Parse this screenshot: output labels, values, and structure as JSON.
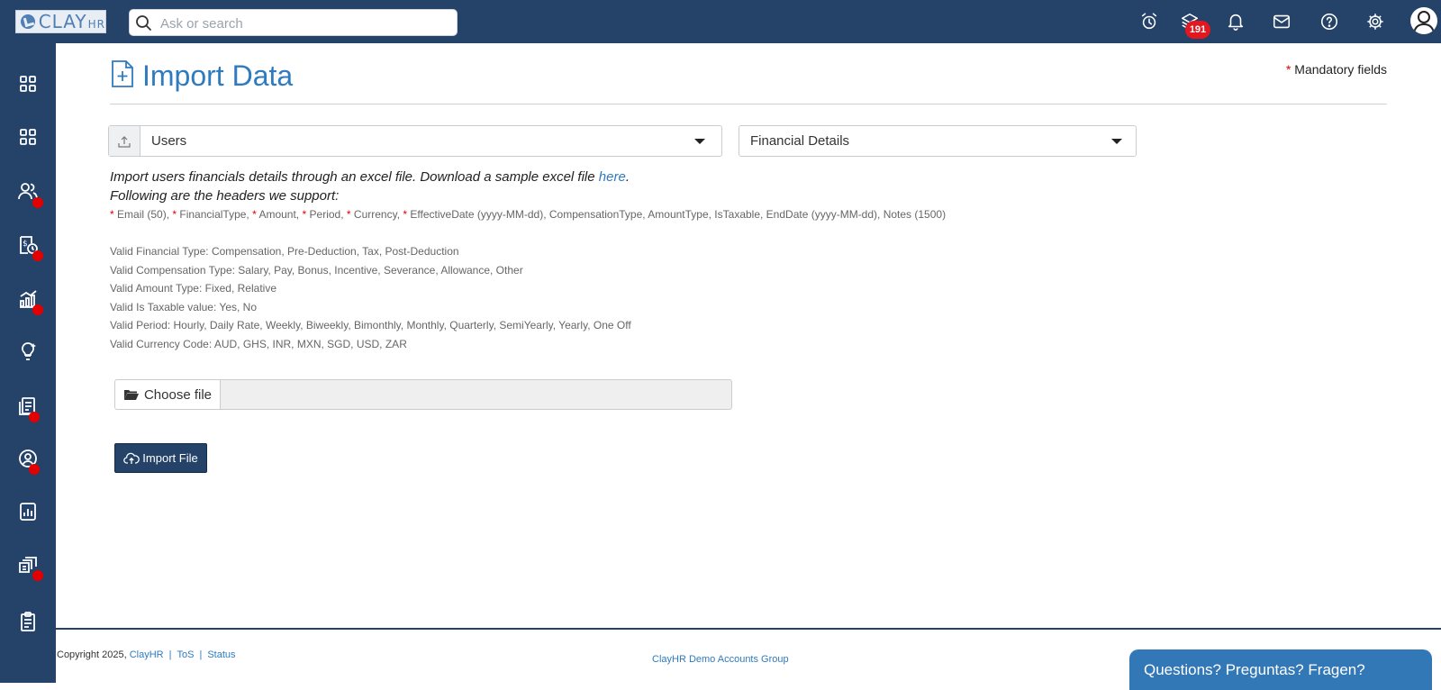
{
  "header": {
    "logo_text": "CLAY",
    "logo_suffix": "HR",
    "search_placeholder": "Ask or search",
    "notification_count": "191",
    "icons": [
      "alarm-clock-icon",
      "layers-icon",
      "bell-icon",
      "mail-icon",
      "help-icon",
      "settings-icon",
      "user-avatar-icon"
    ]
  },
  "sidebar": {
    "items": [
      {
        "icon": "dashboard-icon",
        "has_dot": false
      },
      {
        "icon": "apps-icon",
        "has_dot": false
      },
      {
        "icon": "people-icon",
        "has_dot": true
      },
      {
        "icon": "payroll-icon",
        "has_dot": true
      },
      {
        "icon": "analytics-icon",
        "has_dot": true
      },
      {
        "icon": "ideas-icon",
        "has_dot": false
      },
      {
        "icon": "documents-icon",
        "has_dot": true
      },
      {
        "icon": "profile-icon",
        "has_dot": true
      },
      {
        "icon": "reports-icon",
        "has_dot": false
      },
      {
        "icon": "support-icon",
        "has_dot": true
      },
      {
        "icon": "checklist-icon",
        "has_dot": false
      }
    ]
  },
  "page": {
    "title": "Import Data",
    "mandatory_asterisk": "*",
    "mandatory_label": "Mandatory fields"
  },
  "form": {
    "type_select_value": "Users",
    "detail_select_value": "Financial Details",
    "description_line1": "Import users financials details through an excel file. Download a sample excel file ",
    "description_link": "here",
    "description_period": ".",
    "description_line2": "Following are the headers we support:",
    "headers": [
      {
        "required": true,
        "text": "Email (50),"
      },
      {
        "required": true,
        "text": "FinancialType,"
      },
      {
        "required": true,
        "text": "Amount,"
      },
      {
        "required": true,
        "text": "Period,"
      },
      {
        "required": true,
        "text": "Currency,"
      },
      {
        "required": true,
        "text": "EffectiveDate (yyyy-MM-dd), CompensationType, AmountType, IsTaxable, EndDate (yyyy-MM-dd), Notes (1500)"
      }
    ],
    "valid_values": [
      "Valid Financial Type: Compensation, Pre-Deduction, Tax, Post-Deduction",
      "Valid Compensation Type: Salary, Pay, Bonus, Incentive, Severance, Allowance, Other",
      "Valid Amount Type: Fixed, Relative",
      "Valid Is Taxable value: Yes, No",
      "Valid Period: Hourly, Daily Rate, Weekly, Biweekly, Bimonthly, Monthly, Quarterly, SemiYearly, Yearly, One Off",
      "Valid Currency Code: AUD, GHS, INR, MXN, SGD, USD, ZAR"
    ],
    "choose_file_label": "Choose file",
    "file_value": "",
    "import_button_label": "Import File"
  },
  "footer": {
    "copyright_prefix": "Copyright 2025,",
    "links": [
      "ClayHR",
      "ToS",
      "Status"
    ],
    "separator": "|",
    "group_name": "ClayHR Demo Accounts Group",
    "help_widget": "Questions? Preguntas? Fragen?"
  },
  "colors": {
    "navy": "#254268",
    "accent_blue": "#2e7bbf",
    "alert_red": "#e30000"
  }
}
